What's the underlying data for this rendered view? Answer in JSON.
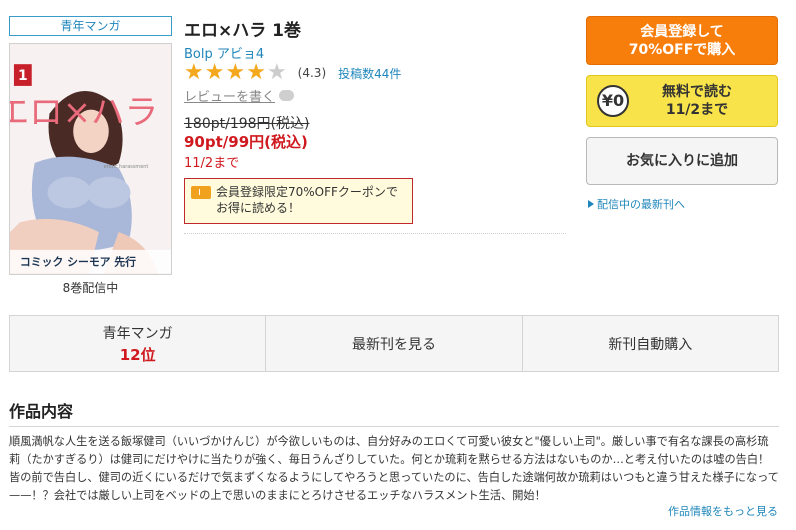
{
  "genre_badge": "青年マンガ",
  "cover": {
    "title_art": "エロ×ハラ",
    "volume_mark": "1",
    "small_text": "erotic harassment",
    "publisher_logo": "コミック シーモア 先行"
  },
  "volume_count": "8巻配信中",
  "title": "エロ×ハラ 1巻",
  "author": "Bolp アビョ4",
  "rating": {
    "stars": 4,
    "stars_max": 5,
    "value": "(4.3)",
    "reviews": "投稿数44件"
  },
  "write_review": "レビューを書く",
  "price": {
    "original": "180pt/198円(税込)",
    "sale": "90pt/99円(税込)",
    "until": "11/2まで"
  },
  "coupon": {
    "line1": "会員登録限定70%OFFクーポンで",
    "line2": "お得に読める！"
  },
  "buttons": {
    "member_line1": "会員登録して",
    "member_line2": "70%OFFで購入",
    "free_icon": "¥0",
    "free_line1": "無料で読む",
    "free_line2": "11/2まで",
    "favorite": "お気に入りに追加"
  },
  "latest_link": "配信中の最新刊へ",
  "tabs": {
    "genre_label": "青年マンガ",
    "genre_rank": "12位",
    "latest": "最新刊を見る",
    "auto_buy": "新刊自動購入"
  },
  "section": {
    "title": "作品内容",
    "description": "順風満帆な人生を送る飯塚健司（いいづかけんじ）が今欲しいものは、自分好みのエロくて可愛い彼女と\"優しい上司\"。厳しい事で有名な課長の高杉琉莉（たかすぎるり）は健司にだけやけに当たりが強く、毎日うんざりしていた。何とか琉莉を黙らせる方法はないものか…と考え付いたのは嘘の告白！皆の前で告白し、健司の近くにいるだけで気まずくなるようにしてやろうと思っていたのに、告白した途端何故か琉莉はいつもと違う甘えた様子になって——！？会社では厳しい上司をベッドの上で思いのままにとろけさせるエッチなハラスメント生活、開始！",
    "more": "作品情報をもっと見る"
  },
  "colors": {
    "accent_blue": "#1f86bb",
    "price_red": "#d0191f",
    "member_orange": "#f87e0c",
    "free_yellow": "#f8e44a",
    "star": "#f3a81d"
  }
}
